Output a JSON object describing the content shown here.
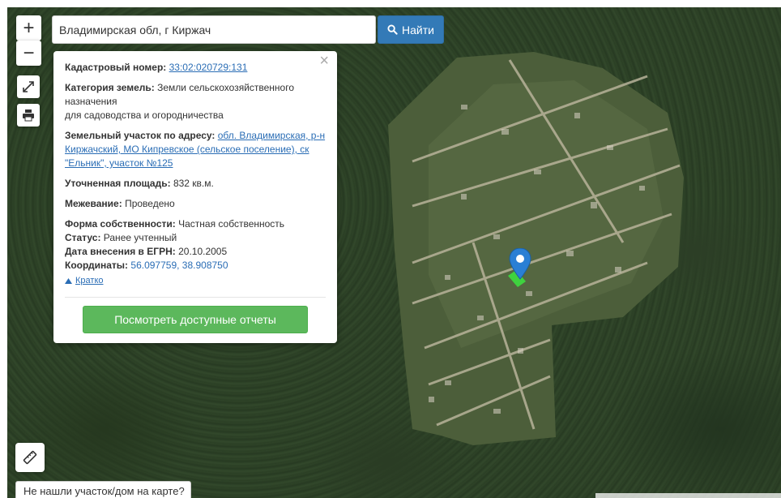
{
  "search": {
    "value": "Владимирская обл, г Киржач",
    "button_label": "Найти"
  },
  "map_controls": {
    "zoom_in": "+",
    "zoom_out": "−"
  },
  "popup": {
    "close": "×",
    "cadastral_label": "Кадастровый номер:",
    "cadastral_value": "33:02:020729:131",
    "category_label": "Категория земель:",
    "category_value_1": "Земли сельскохозяйственного",
    "category_value_2": "назначения",
    "category_value_3": "для садоводства и огородничества",
    "address_label": "Земельный участок по адресу:",
    "address_value": "обл. Владимирская, р-н Киржачский, МО Кипревское (сельское поселение), ск \"Ельник\", участок №125",
    "area_label": "Уточненная площадь:",
    "area_value": "832 кв.м.",
    "survey_label": "Межевание:",
    "survey_value": "Проведено",
    "ownership_label": "Форма собственности:",
    "ownership_value": "Частная собственность",
    "status_label": "Статус:",
    "status_value": "Ранее учтенный",
    "egrn_date_label": "Дата внесения в ЕГРН:",
    "egrn_date_value": "20.10.2005",
    "coords_label": "Координаты:",
    "coords_value": "56.097759, 38.908750",
    "brief_link": "Кратко",
    "reports_button": "Посмотреть доступные отчеты"
  },
  "footer": {
    "not_found": "Не нашли участок/дом на карте?"
  },
  "colors": {
    "search_button": "#337ab7",
    "reports_button": "#5cb85c",
    "link": "#2a6db5",
    "marker": "#2a7fd4",
    "parcel": "#3fd23f"
  },
  "icons": {
    "search": "magnifier-icon",
    "fullscreen": "expand-arrows-icon",
    "print": "printer-icon",
    "ruler": "ruler-icon",
    "marker": "map-pin-icon",
    "brief": "triangle-up-icon"
  }
}
